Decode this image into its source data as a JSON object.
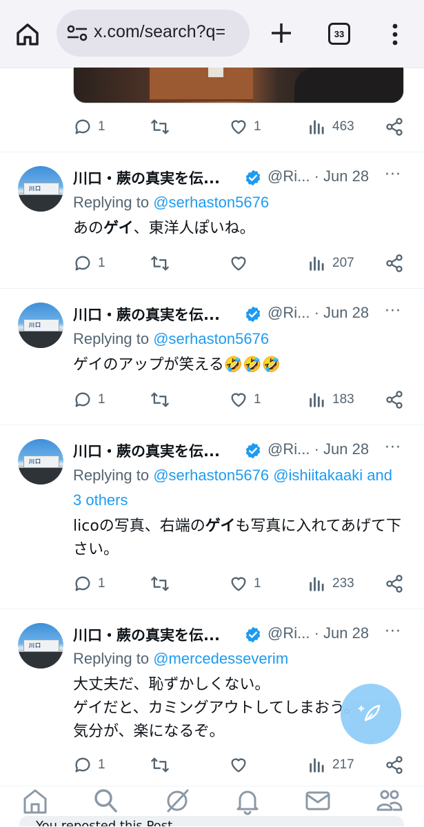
{
  "browser": {
    "url": "x.com/search?q=",
    "tab_count": "33"
  },
  "prev_tweet": {
    "replies": "1",
    "likes": "1",
    "views": "463"
  },
  "tweets": [
    {
      "name": "川口・蕨の真実を伝...",
      "handle": "@Ri...",
      "date": "· Jun 28",
      "replying_label": "Replying to",
      "mentions": "@serhaston5676",
      "body_html": "あの<b>ゲイ</b>、東洋人ぽいね。",
      "replies": "1",
      "likes": "",
      "views": "207"
    },
    {
      "name": "川口・蕨の真実を伝...",
      "handle": "@Ri...",
      "date": "· Jun 28",
      "replying_label": "Replying to",
      "mentions": "@serhaston5676",
      "body_html": "ゲイのアップが笑える🤣🤣🤣",
      "replies": "1",
      "likes": "1",
      "views": "183"
    },
    {
      "name": "川口・蕨の真実を伝...",
      "handle": "@Ri...",
      "date": "· Jun 28",
      "replying_label": "Replying to",
      "mentions": "@serhaston5676 @ishiitakaaki and 3 others",
      "body_html": "licoの写真、右端の<b>ゲイ</b>も写真に入れてあげて下さい。",
      "replies": "1",
      "likes": "1",
      "views": "233"
    },
    {
      "name": "川口・蕨の真実を伝...",
      "handle": "@Ri...",
      "date": "· Jun 28",
      "replying_label": "Replying to",
      "mentions": "@mercedesseverim",
      "body_html": "大丈夫だ、恥ずかしくない。<br>ゲイだと、カミングアウトしてしまおう。<br>気分が、楽になるぞ。",
      "replies": "1",
      "likes": "",
      "views": "217"
    }
  ],
  "more_label": "···",
  "peek_text": "You reposted this Post",
  "colors": {
    "accent": "#1d9bf0",
    "secondary_text": "#536471",
    "verified": "#1d9bf0"
  },
  "icons": [
    "home-icon",
    "tune-icon",
    "plus-icon",
    "tabs-icon",
    "kebab-icon",
    "reply-icon",
    "retweet-icon",
    "like-icon",
    "views-icon",
    "share-icon",
    "verified-icon",
    "more-icon",
    "compose-icon",
    "nav-home-icon",
    "nav-search-icon",
    "nav-grok-icon",
    "nav-notifications-icon",
    "nav-messages-icon",
    "nav-communities-icon"
  ]
}
